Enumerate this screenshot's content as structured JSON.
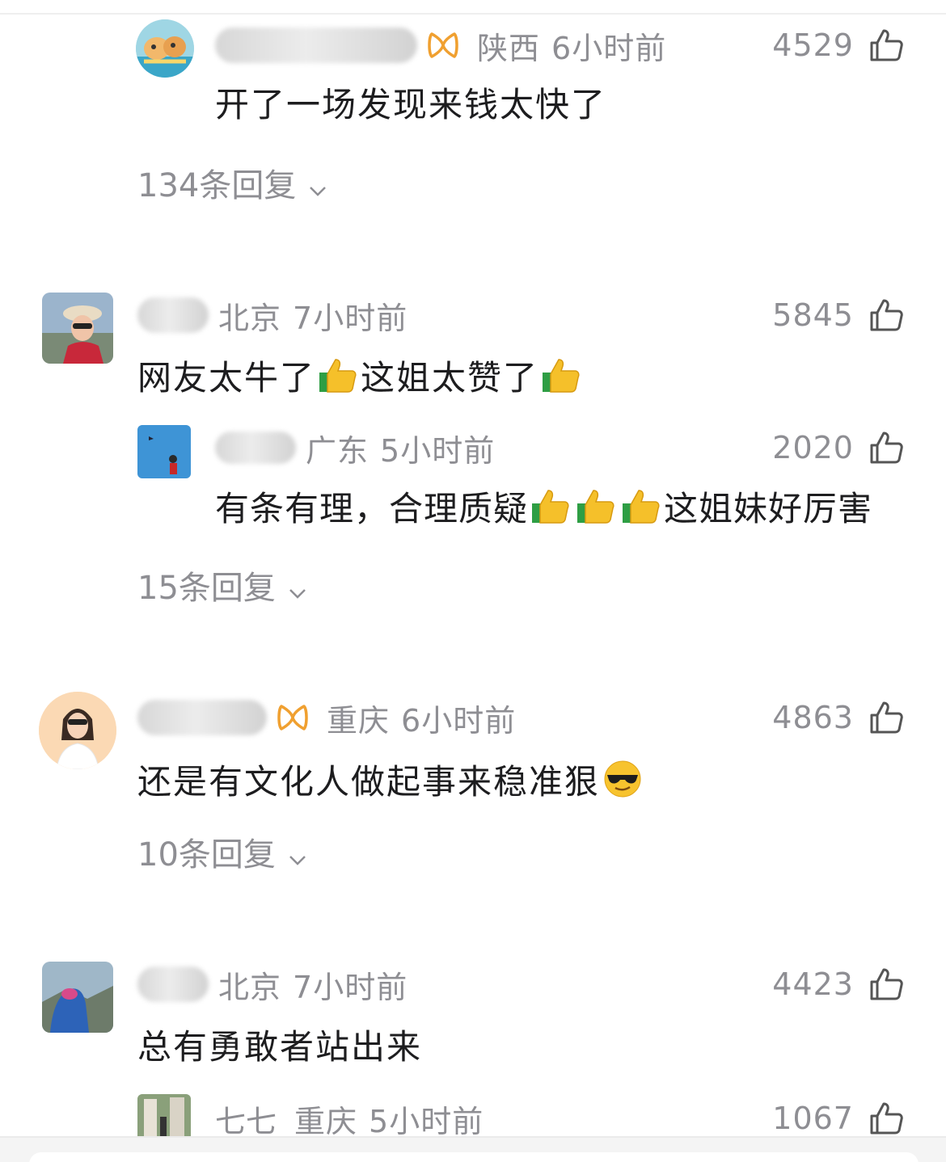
{
  "comments": [
    {
      "location": "陕西",
      "time": "6小时前",
      "likes": "4529",
      "text": "开了一场发现来钱太快了",
      "replies_label": "134条回复"
    },
    {
      "location": "北京",
      "time": "7小时前",
      "likes": "5845",
      "text_part1": "网友太牛了",
      "text_part2": "这姐太赞了",
      "reply": {
        "location": "广东",
        "time": "5小时前",
        "likes": "2020",
        "text_part1": "有条有理，合理质疑",
        "text_part2": "这姐妹好厉害"
      },
      "replies_label": "15条回复"
    },
    {
      "location": "重庆",
      "time": "6小时前",
      "likes": "4863",
      "text": "还是有文化人做起事来稳准狠",
      "replies_label": "10条回复"
    },
    {
      "location": "北京",
      "time": "7小时前",
      "likes": "4423",
      "text": "总有勇敢者站出来",
      "reply": {
        "name": "七七",
        "location": "重庆",
        "time": "5小时前",
        "likes": "1067"
      }
    }
  ],
  "icons": {
    "like": "thumbs-up-outline-icon",
    "badge": "orange-bow-badge-icon",
    "thumbs_emoji": "thumbs-up-emoji",
    "sunglasses_emoji": "sunglasses-face-emoji",
    "chevron": "chevron-down-icon"
  },
  "colors": {
    "meta_text": "#8e8e93",
    "content_text": "#1d1d1f",
    "badge": "#f0a030"
  }
}
